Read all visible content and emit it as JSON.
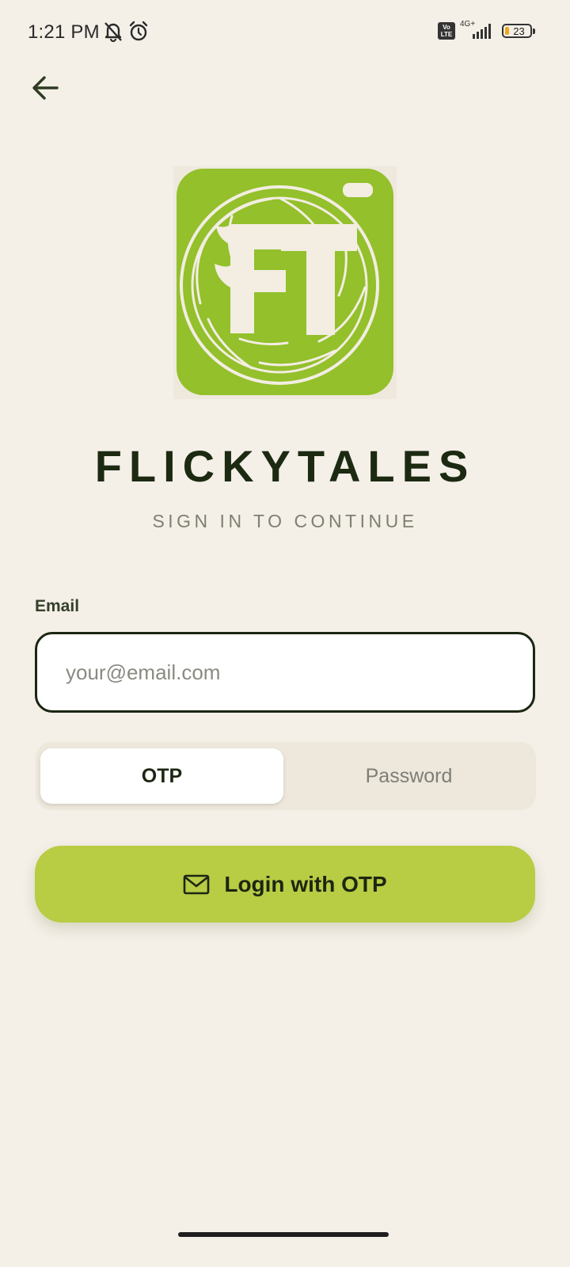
{
  "status_bar": {
    "time": "1:21 PM",
    "icons": [
      "bell-off-icon",
      "alarm-icon"
    ],
    "volte": "Vo\nLTE",
    "network": "4G+",
    "battery_percent": "23",
    "battery_level": 0.23
  },
  "header": {
    "back_icon": "arrow-left-icon"
  },
  "logo": {
    "monogram": "FT",
    "brand_color": "#93c02b"
  },
  "title": "FLICKYTALES",
  "subtitle": "SIGN IN TO CONTINUE",
  "form": {
    "email_label": "Email",
    "email_placeholder": "your@email.com",
    "email_value": "",
    "mode_options": [
      "OTP",
      "Password"
    ],
    "selected_mode": "OTP",
    "submit_icon": "mail-icon",
    "submit_label": "Login with OTP"
  },
  "colors": {
    "background": "#f4efe7",
    "accent": "#b8cc44",
    "text_dark": "#1c2a12"
  }
}
